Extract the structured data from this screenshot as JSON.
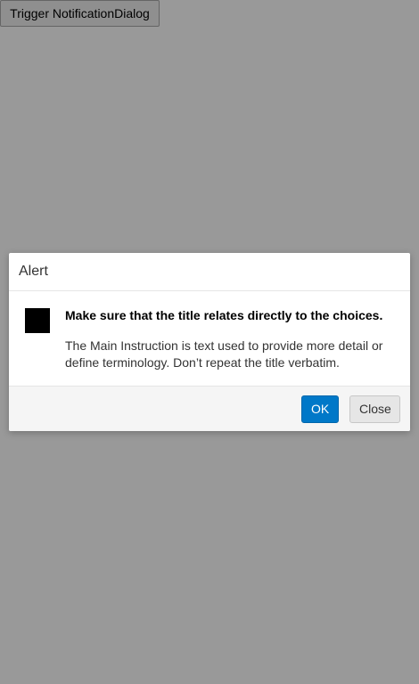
{
  "trigger": {
    "label": "Trigger NotificationDialog"
  },
  "dialog": {
    "title": "Alert",
    "icon": "alert-icon",
    "main_instruction": "Make sure that the title relates directly to the choices.",
    "content": "The Main Instruction is text used to provide more detail or define terminology. Don’t repeat the title verbatim.",
    "buttons": {
      "ok_label": "OK",
      "close_label": "Close"
    }
  },
  "colors": {
    "primary_button": "#0078c8",
    "overlay": "rgba(0,0,0,0.4)"
  }
}
